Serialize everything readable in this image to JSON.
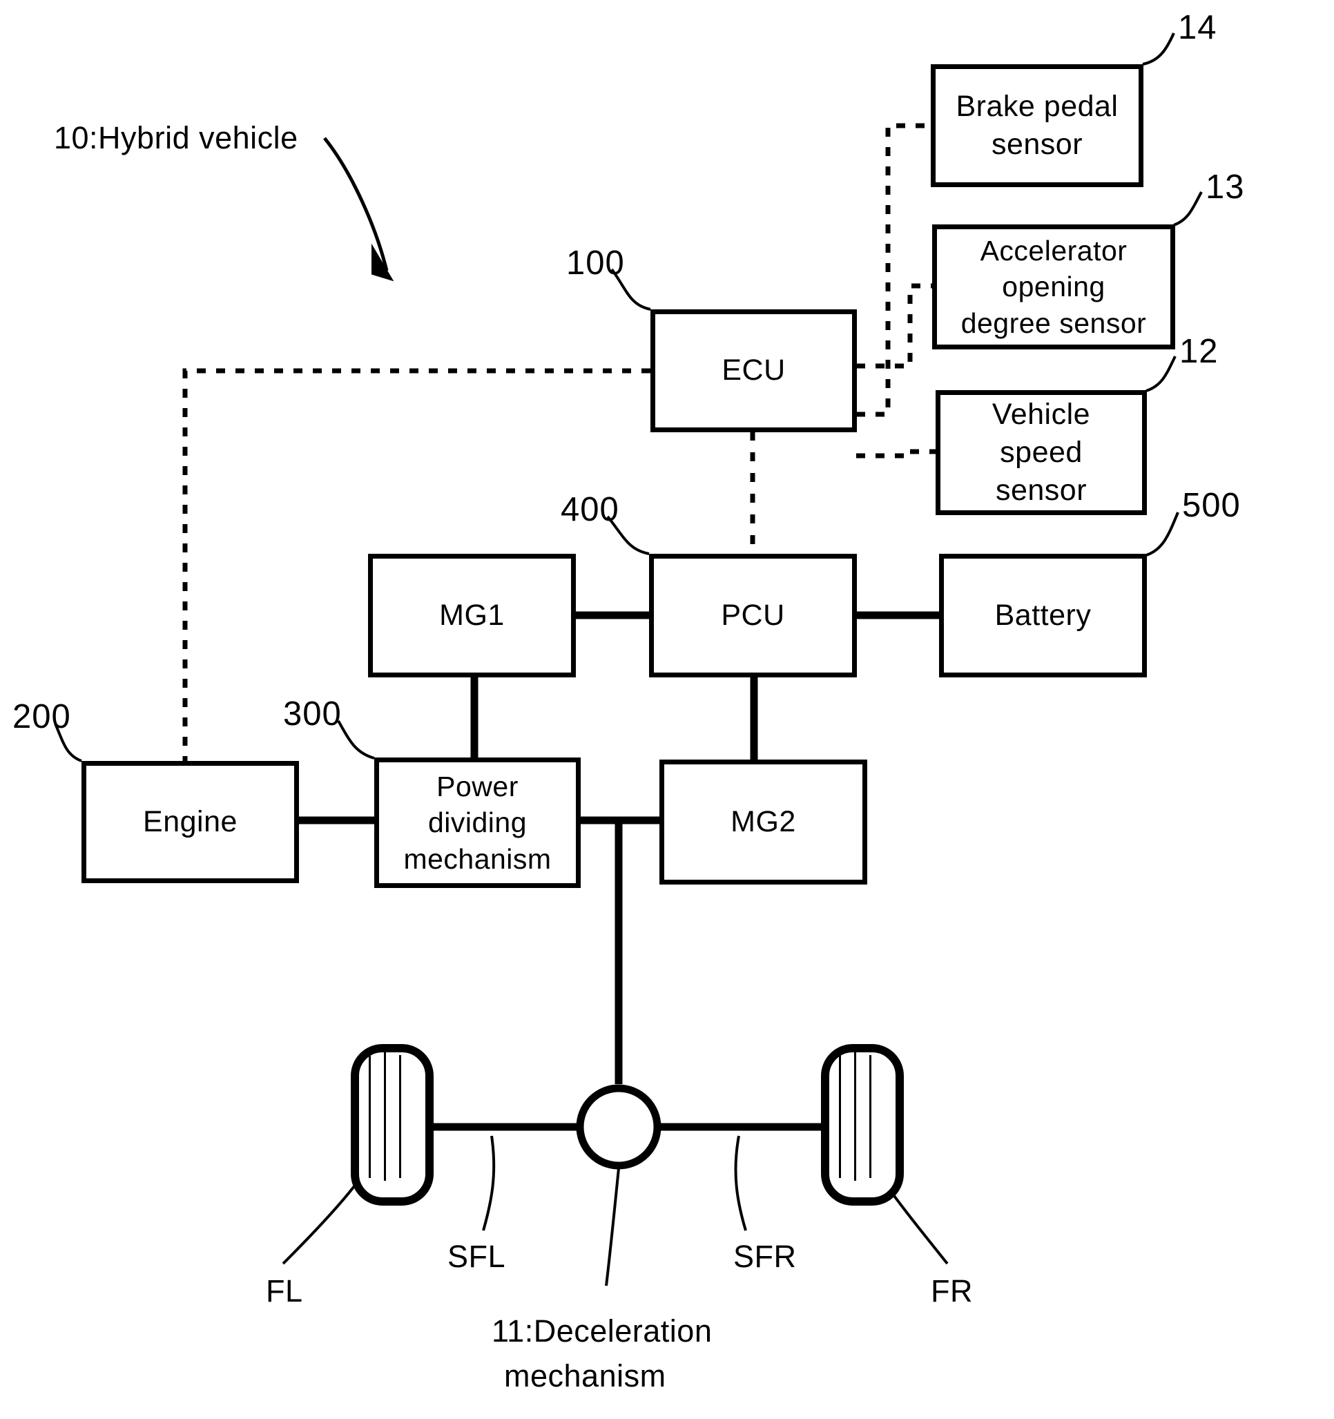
{
  "figure": {
    "title_label": "10:Hybrid vehicle",
    "bottom_caption_line1": "11:Deceleration",
    "bottom_caption_line2": "mechanism"
  },
  "blocks": [
    {
      "id": "brake-pedal-sensor",
      "label": "Brake pedal\nsensor",
      "ref": "14"
    },
    {
      "id": "accelerator-opening-degree-sensor",
      "label": "Accelerator\nopening\ndegree sensor",
      "ref": "13"
    },
    {
      "id": "vehicle-speed-sensor",
      "label": "Vehicle\nspeed\nsensor",
      "ref": "12"
    },
    {
      "id": "ecu",
      "label": "ECU",
      "ref": "100"
    },
    {
      "id": "mg1",
      "label": "MG1",
      "ref": ""
    },
    {
      "id": "pcu",
      "label": "PCU",
      "ref": "400"
    },
    {
      "id": "battery",
      "label": "Battery",
      "ref": "500"
    },
    {
      "id": "engine",
      "label": "Engine",
      "ref": "200"
    },
    {
      "id": "power-dividing-mechanism",
      "label": "Power\ndividing\nmechanism",
      "ref": "300"
    },
    {
      "id": "mg2",
      "label": "MG2",
      "ref": ""
    }
  ],
  "labels": {
    "brake_pedal_sensor": "Brake pedal\nsensor",
    "accelerator_sensor": "Accelerator\nopening\ndegree sensor",
    "vehicle_speed_sensor": "Vehicle\nspeed\nsensor",
    "ecu": "ECU",
    "mg1": "MG1",
    "pcu": "PCU",
    "battery": "Battery",
    "engine": "Engine",
    "power_dividing_mechanism": "Power\ndividing\nmechanism",
    "mg2": "MG2"
  },
  "refs": {
    "brake_pedal_sensor": "14",
    "accelerator_sensor": "13",
    "vehicle_speed_sensor": "12",
    "ecu": "100",
    "pcu": "400",
    "battery": "500",
    "engine": "200",
    "power_dividing_mechanism": "300",
    "hybrid_vehicle": "10:Hybrid vehicle"
  },
  "wheels": {
    "front_left": "FL",
    "front_right": "FR",
    "shaft_left": "SFL",
    "shaft_right": "SFR"
  },
  "colors": {
    "stroke": "#000000",
    "background": "#ffffff"
  }
}
